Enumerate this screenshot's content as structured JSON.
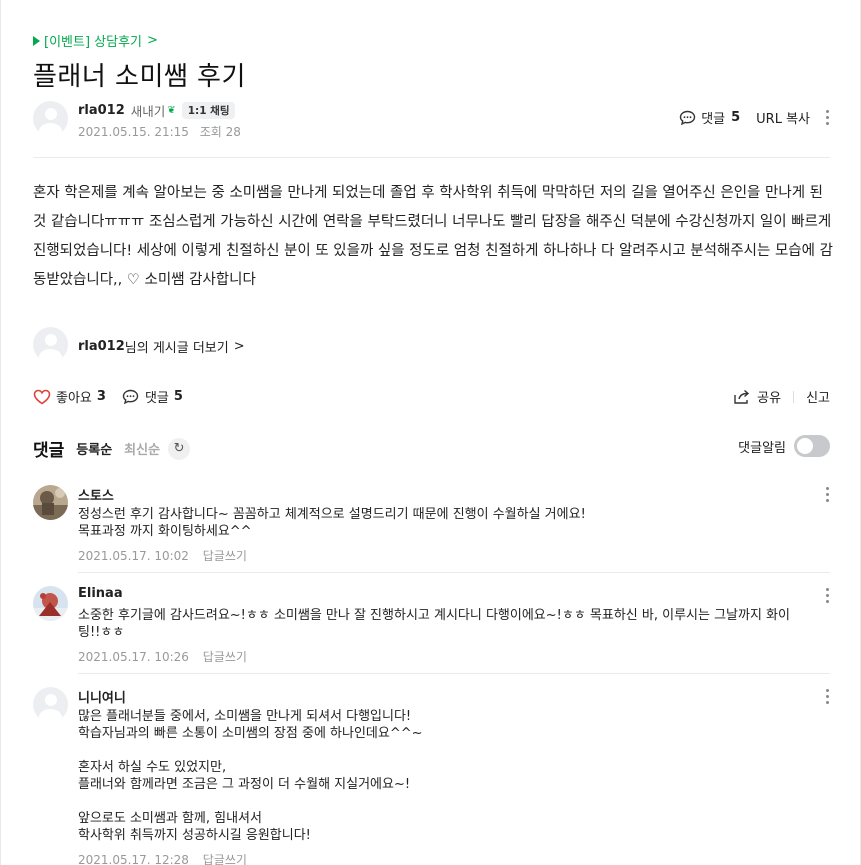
{
  "board": {
    "label": "[이벤트] 상담후기",
    "chevron": ">"
  },
  "post": {
    "title": "플래너 소미쌤 후기",
    "author": "rla012",
    "author_level": "새내기",
    "level_icon": "sprout-icon",
    "chat_label": "1:1 채팅",
    "date": "2021.05.15. 21:15",
    "views_label": "조회 28",
    "body": "혼자 학은제를 계속 알아보는 중 소미쌤을 만나게 되었는데 졸업 후 학사학위 취득에 막막하던 저의 길을 열어주신 은인을 만나게 된 것 같습니다ㅠㅠㅠ 조심스럽게 가능하신 시간에 연락을 부탁드렸더니 너무나도 빨리 답장을 해주신 덕분에 수강신청까지 일이 빠르게 진행되었습니다! 세상에 이렇게 친절하신 분이 또 있을까 싶을 정도로 엄청 친절하게 하나하나 다 알려주시고 분석해주시는 모습에 감동받았습니다,, ♡ 소미쌤 감사합니다"
  },
  "top_actions": {
    "comment_label": "댓글",
    "comment_count": "5",
    "url_copy": "URL 복사"
  },
  "more_posts": {
    "author": "rla012",
    "suffix": "님의 게시글 더보기",
    "chevron": ">"
  },
  "actions": {
    "like_label": "좋아요",
    "like_count": "3",
    "comment_label": "댓글",
    "comment_count": "5",
    "share_label": "공유",
    "report_label": "신고"
  },
  "comments_section": {
    "title": "댓글",
    "sort_registered": "등록순",
    "sort_latest": "최신순",
    "notify_label": "댓글알림",
    "notify_on": false
  },
  "comments": [
    {
      "name": "스토스",
      "text": "정성스런 후기 감사합니다~ 꼼꼼하고 체계적으로 설명드리기 때문에 진행이 수월하실 거에요!\n목표과정 까지 화이팅하세요^^",
      "date": "2021.05.17. 10:02",
      "reply": "답글쓰기"
    },
    {
      "name": "Elinaa",
      "text": "소중한 후기글에 감사드려요~!ㅎㅎ 소미쌤을 만나 잘 진행하시고 계시다니 다행이에요~!ㅎㅎ 목표하신 바, 이루시는 그날까지 화이팅!!ㅎㅎ",
      "date": "2021.05.17. 10:26",
      "reply": "답글쓰기"
    },
    {
      "name": "니니여니",
      "text": "많은 플래너분들 중에서, 소미쌤을 만나게 되셔서 다행입니다!\n학습자님과의 빠른 소통이 소미쌤의 장점 중에 하나인데요^^~\n\n혼자서 하실 수도 있었지만,\n플래너와 함께라면 조금은 그 과정이 더 수월해 지실거에요~!\n\n앞으로도 소미쌤과 함께, 힘내셔서\n학사학위 취득까지 성공하시길 응원합니다!",
      "date": "2021.05.17. 12:28",
      "reply": "답글쓰기"
    }
  ],
  "colors": {
    "accent_green": "#03a94d",
    "like_red": "#e0433b",
    "meta_gray": "#999999"
  }
}
